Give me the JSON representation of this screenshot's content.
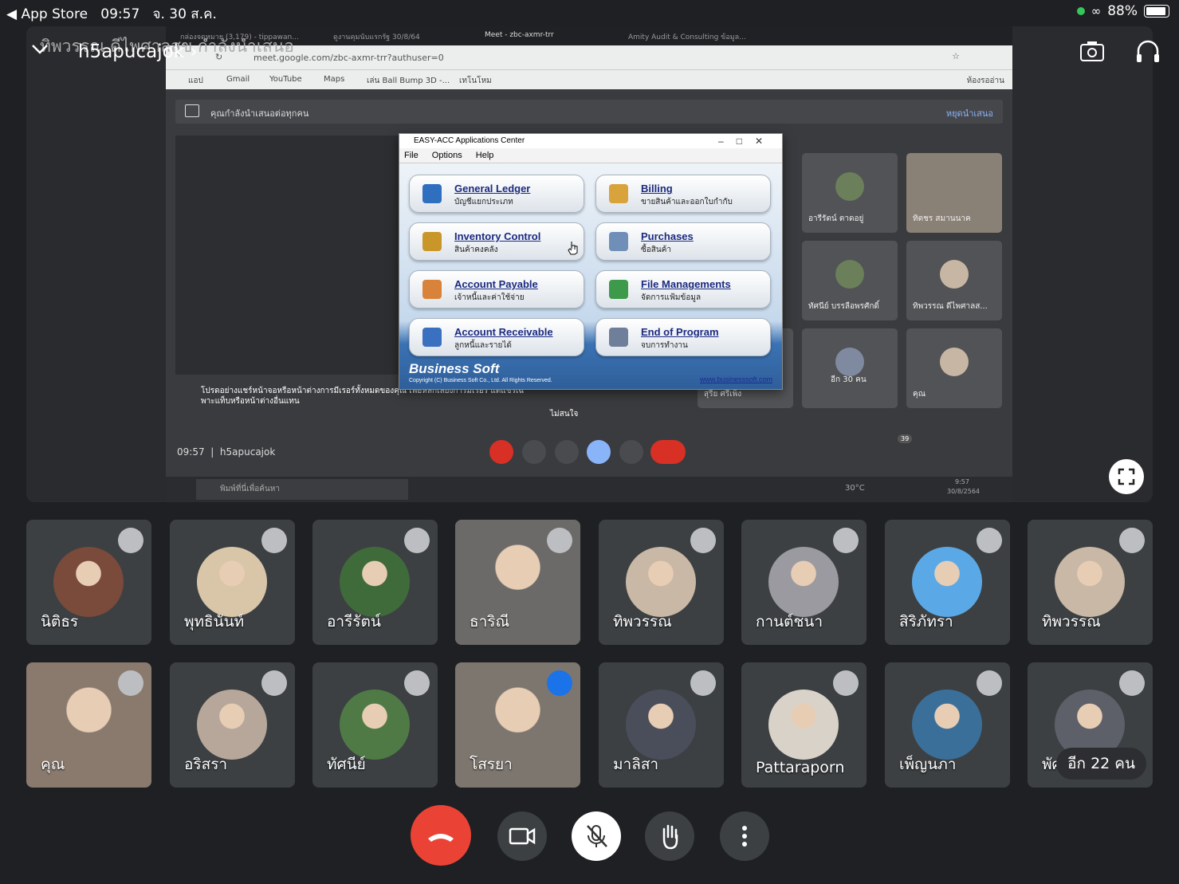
{
  "status_bar": {
    "back_app": "App Store",
    "time": "09:57",
    "date": "จ. 30 ส.ค.",
    "battery": "88%"
  },
  "meet_header": {
    "presenter": "h5apucajok",
    "overlay_text": "ทิพวรรณ ดีไพศาลสุข กำลังนำเสนอ"
  },
  "browser": {
    "tabs": [
      "กล่องจดหมาย (3,179) - tippawan...",
      "ดูงานคุมนับแรกรัฐ 30/8/64",
      "Meet - zbc-axmr-trr",
      "Amity Audit & Consulting ข้อมูล..."
    ],
    "url": "meet.google.com/zbc-axmr-trr?authuser=0",
    "bookmarks": [
      "แอป",
      "Gmail",
      "YouTube",
      "Maps",
      "เล่น Ball Bump 3D -...",
      "เทโนโหม",
      "ห้องรออ่าน"
    ]
  },
  "meet_inner": {
    "banner": "คุณกำลังนำเสนอต่อทุกคน",
    "stop_presenting": "หยุดนำเสนอ",
    "share_warning": "โปรดอย่างแชร์หน้าจอหรือหน้าต่างการมีเรอร์ทั้งหมดของคุณ เพื่อหลีกเลี่ยงการมีเรอร์ แต่แชร์เฉพาะแท็บหรือหน้าต่างอื่นแทน",
    "dismiss": "ไม่สนใจ",
    "time": "09:57",
    "code": "h5apucajok",
    "people_count": "39",
    "tiles": [
      {
        "name": "อารีรัตน์ ตาดอยู่"
      },
      {
        "name": "ทิตชร สมานนาค"
      },
      {
        "name": "ทัศนีย์ บรรลือพรศักดิ์"
      },
      {
        "name": "ทิพวรรณ ดีไพศาลส..."
      },
      {
        "name": "สุรีย ศรีเพ็ง"
      },
      {
        "name": "อีก 30 คน"
      },
      {
        "name": "คุณ"
      }
    ],
    "taskbar_search": "พิมพ์ที่นี่เพื่อค้นหา",
    "weather": "30°C",
    "clock": "9:57",
    "clock_date": "30/8/2564"
  },
  "easy_acc": {
    "title": "EASY-ACC Applications Center",
    "menu": [
      "File",
      "Options",
      "Help"
    ],
    "buttons": [
      {
        "title": "General Ledger",
        "subtitle": "บัญชีแยกประเภท",
        "color": "#2f6fbf"
      },
      {
        "title": "Billing",
        "subtitle": "ขายสินค้าและออกใบกำกับ",
        "color": "#d8a33b"
      },
      {
        "title": "Inventory Control",
        "subtitle": "สินค้าคงคลัง",
        "color": "#c9962a"
      },
      {
        "title": "Purchases",
        "subtitle": "ซื้อสินค้า",
        "color": "#6f8fb8"
      },
      {
        "title": "Account Payable",
        "subtitle": "เจ้าหนี้และค่าใช้จ่าย",
        "color": "#d9823a"
      },
      {
        "title": "File Managements",
        "subtitle": "จัดการแฟ้มข้อมูล",
        "color": "#3d9a4a"
      },
      {
        "title": "Account Receivable",
        "subtitle": "ลูกหนี้และรายได้",
        "color": "#3a70c0"
      },
      {
        "title": "End of Program",
        "subtitle": "จบการทำงาน",
        "color": "#6f7f9a"
      }
    ],
    "brand": "Business Soft",
    "copyright": "Copyright (C) Business Soft Co., Ltd. All Rights Reserved.",
    "website": "www.businesssoft.com"
  },
  "participants": [
    {
      "name": "นิติธร",
      "color": "#7a4a3a"
    },
    {
      "name": "พุทธินันท์",
      "color": "#d9c6a8"
    },
    {
      "name": "อารีรัตน์",
      "color": "#3f6b3a"
    },
    {
      "name": "ธาริณี",
      "color": "#6b6a68"
    },
    {
      "name": "ทิพวรรณ",
      "color": "#c9b8a6"
    },
    {
      "name": "กานต์ชนา",
      "color": "#9a9aa0"
    },
    {
      "name": "สิริภัทรา",
      "color": "#5aa9e6"
    },
    {
      "name": "ทิพวรรณ",
      "color": "#c9b8a6"
    },
    {
      "name": "คุณ",
      "color": "#8a7a6e"
    },
    {
      "name": "อริสรา",
      "color": "#b7a79a"
    },
    {
      "name": "ทัศนีย์",
      "color": "#4f7a45"
    },
    {
      "name": "โสรยา",
      "color": "#7d766e"
    },
    {
      "name": "มาลิสา",
      "color": "#4a4e5a"
    },
    {
      "name": "Pattaraporn",
      "color": "#d8d2c8"
    },
    {
      "name": "เพ็ญนภา",
      "color": "#3a6f9a"
    },
    {
      "name": "พัศ",
      "color": "#5d6068"
    }
  ],
  "more_people": "อีก 22 คน",
  "colors": {
    "end_call": "#ea4335",
    "speaking": "#1a73e8",
    "tile_bg": "#3c4043"
  }
}
